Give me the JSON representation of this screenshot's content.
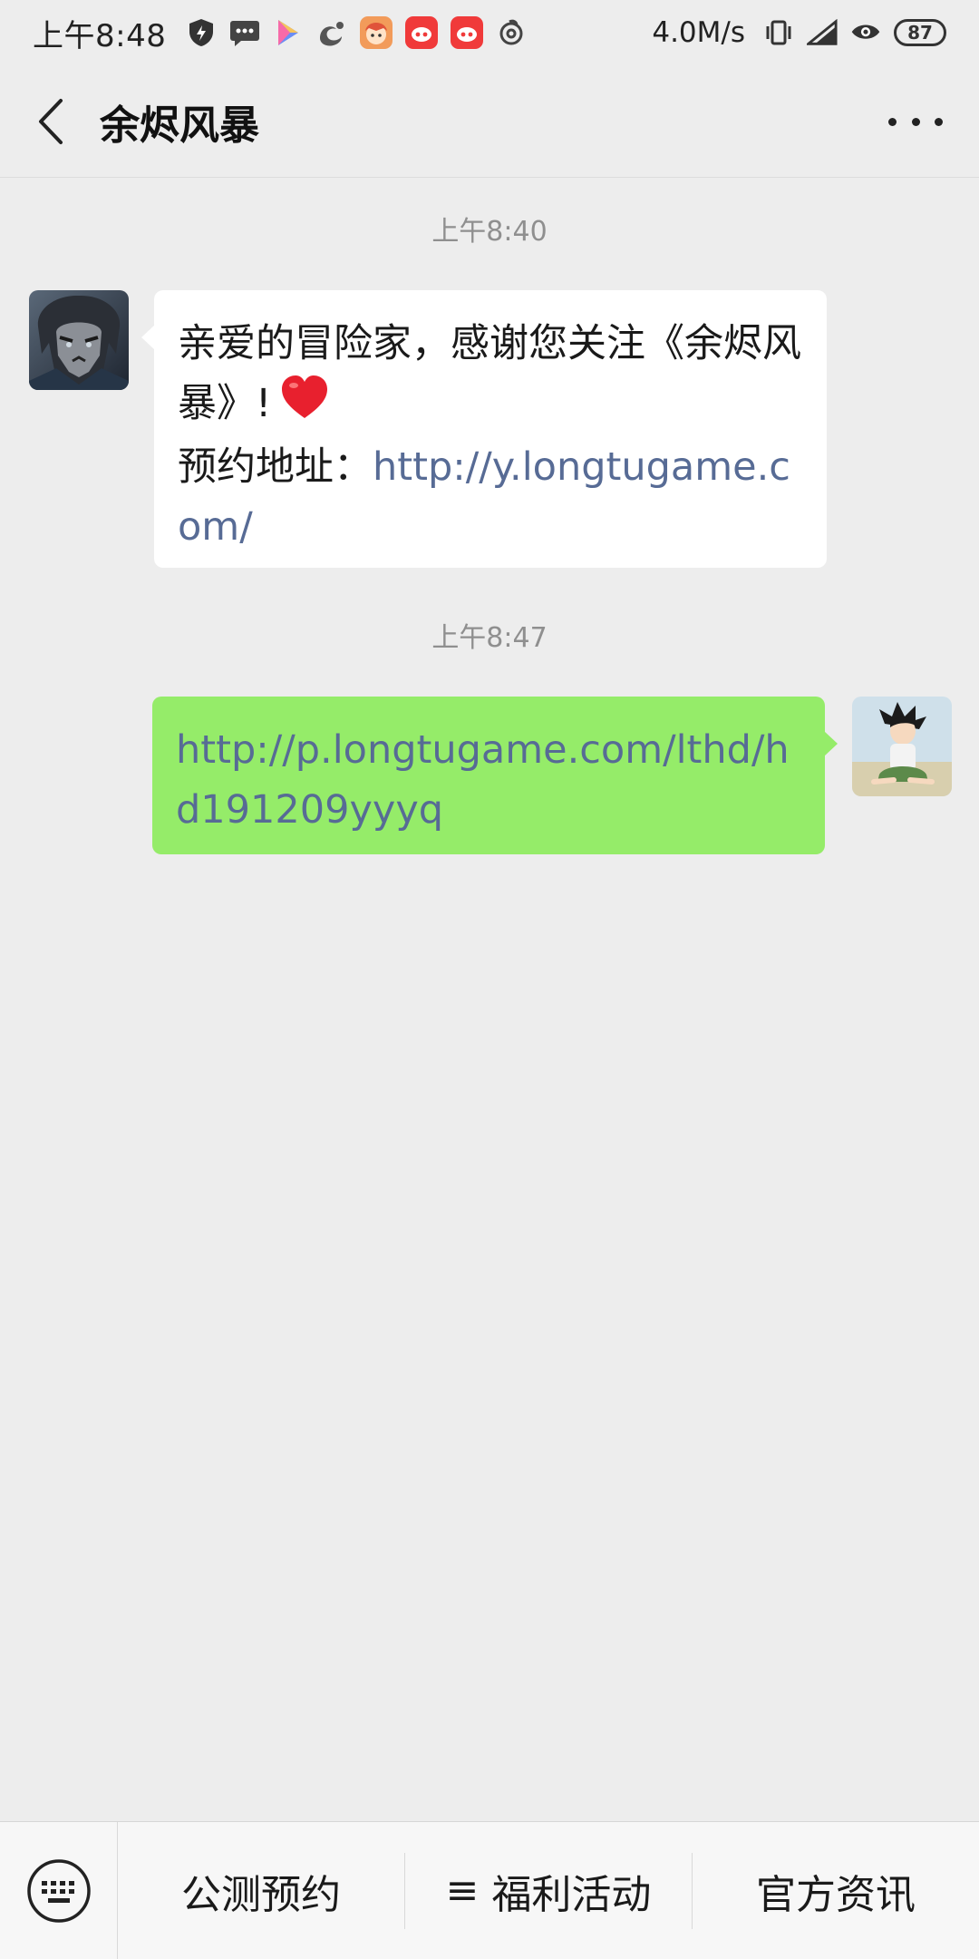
{
  "status_bar": {
    "time": "上午8:48",
    "network_speed": "4.0M/s",
    "battery": "87"
  },
  "header": {
    "title": "余烬风暴"
  },
  "messages": [
    {
      "timestamp": "上午8:40",
      "direction": "incoming",
      "line1": "亲爱的冒险家，感谢您关注《余烬风暴》!",
      "address_label": "预约地址：",
      "link": "http://y.longtugame.com/"
    },
    {
      "timestamp": "上午8:47",
      "direction": "outgoing",
      "link": "http://p.longtugame.com/lthd/hd191209yyyq"
    }
  ],
  "bottom_menu": {
    "items": [
      {
        "label": "公测预约"
      },
      {
        "prefix": "≡",
        "label": "福利活动"
      },
      {
        "label": "官方资讯"
      }
    ]
  },
  "colors": {
    "background": "#EDEDED",
    "outgoing_bubble": "#95EC69",
    "incoming_bubble": "#FFFFFF",
    "link": "#576B95"
  },
  "icons": [
    "shield-icon",
    "sms-icon",
    "play-store-icon",
    "uc-browser-icon",
    "anime-app-icon",
    "weibo-icon",
    "netease-music-icon",
    "vibrate-icon",
    "signal-icon",
    "eye-icon",
    "battery-icon",
    "back-arrow-icon",
    "more-icon",
    "keyboard-icon",
    "heart-emoji"
  ]
}
